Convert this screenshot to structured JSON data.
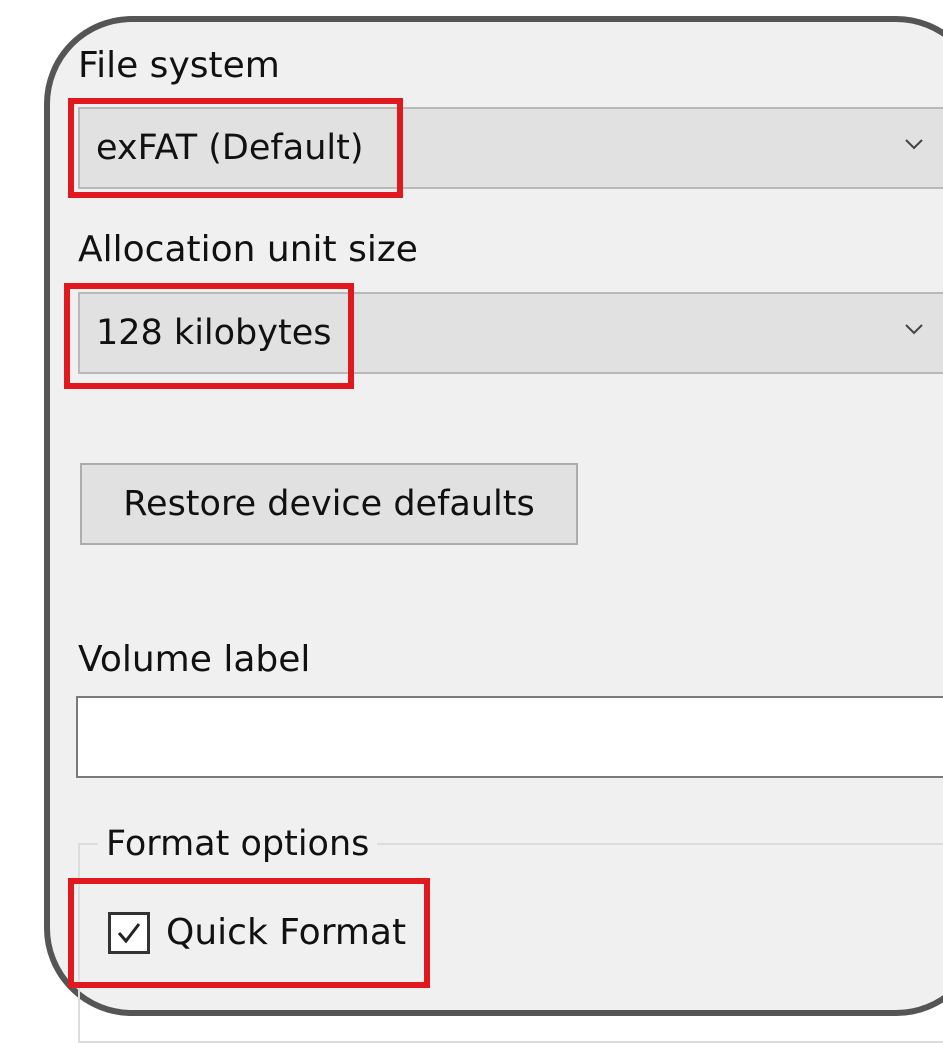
{
  "file_system": {
    "label": "File system",
    "selected": "exFAT (Default)",
    "chevron_icon": "chevron-down-icon"
  },
  "allocation_unit": {
    "label": "Allocation unit size",
    "selected": "128 kilobytes",
    "chevron_icon": "chevron-down-icon"
  },
  "restore_button": {
    "label": "Restore device defaults"
  },
  "volume_label": {
    "label": "Volume label",
    "value": ""
  },
  "format_options": {
    "title": "Format options",
    "quick_format": {
      "label": "Quick Format",
      "checked": true,
      "icon": "checkmark-icon"
    }
  },
  "colors": {
    "highlight": "#e0191e",
    "dialog_background": "#f0f0f0",
    "frame_border": "#555555"
  }
}
